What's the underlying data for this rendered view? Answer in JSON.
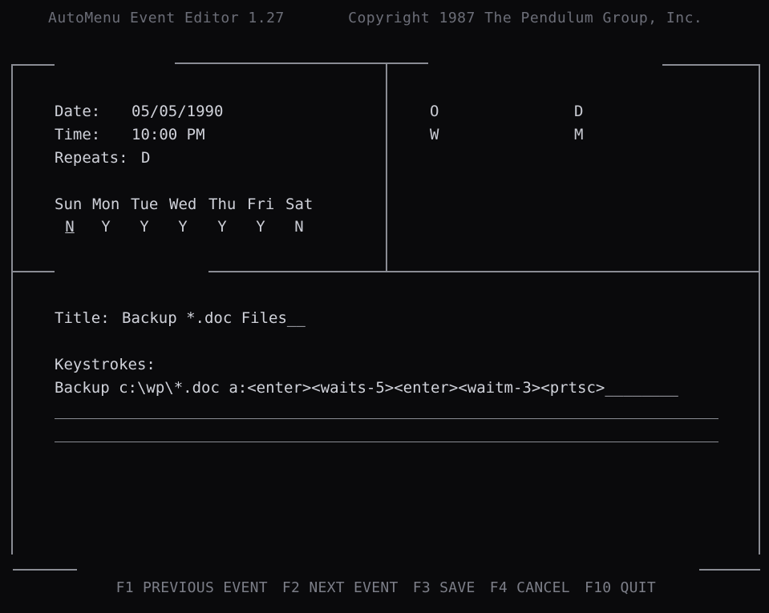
{
  "header": {
    "title": "AutoMenu Event Editor 1.27",
    "copyright": "Copyright 1987 The Pendulum Group, Inc."
  },
  "schedule": {
    "date_label": "Date:",
    "date_value": "05/05/1990",
    "time_label": "Time:",
    "time_value": "10:00 PM",
    "repeats_label": "Repeats:",
    "repeats_value": "D",
    "days": [
      {
        "name": "Sun",
        "flag": "N"
      },
      {
        "name": "Mon",
        "flag": "Y"
      },
      {
        "name": "Tue",
        "flag": "Y"
      },
      {
        "name": "Wed",
        "flag": "Y"
      },
      {
        "name": "Thu",
        "flag": "Y"
      },
      {
        "name": "Fri",
        "flag": "Y"
      },
      {
        "name": "Sat",
        "flag": "N"
      }
    ]
  },
  "flags": {
    "row1_left": "O",
    "row1_right": "D",
    "row2_left": "W",
    "row2_right": "M"
  },
  "event": {
    "title_label": "Title:",
    "title_value": "Backup *.doc Files__",
    "keystrokes_label": "Keystrokes:",
    "keystrokes_value": "Backup c:\\wp\\*.doc a:<enter><waits-5><enter><waitm-3><prtsc>________"
  },
  "function_keys": [
    {
      "key": "F1",
      "label": "PREVIOUS EVENT"
    },
    {
      "key": "F2",
      "label": "NEXT EVENT"
    },
    {
      "key": "F3",
      "label": "SAVE"
    },
    {
      "key": "F4",
      "label": "CANCEL"
    },
    {
      "key": "F10",
      "label": "QUIT"
    }
  ]
}
